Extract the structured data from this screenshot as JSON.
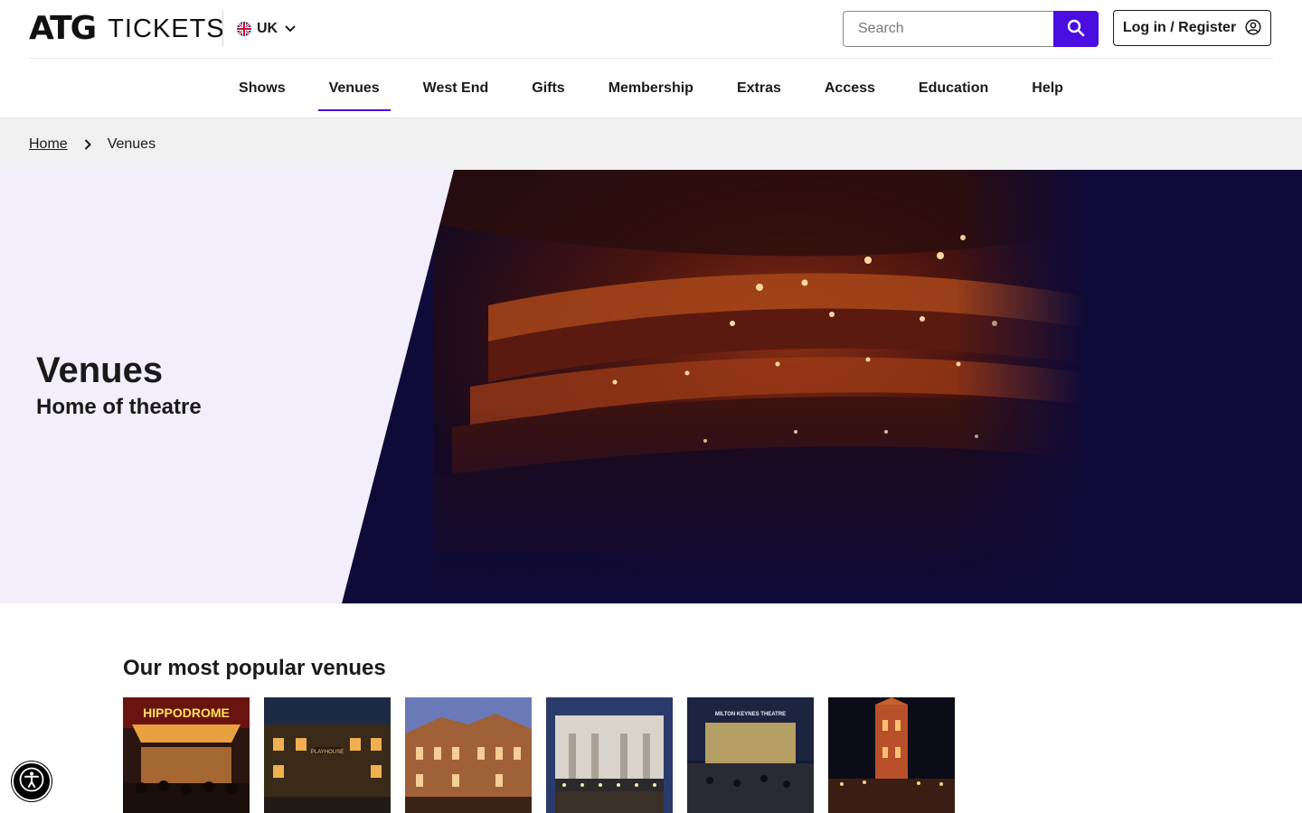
{
  "header": {
    "logo_mark": "ATG",
    "logo_text": "TICKETS",
    "region": {
      "label": "UK",
      "flag_icon": "uk-flag-icon"
    },
    "search": {
      "placeholder": "Search",
      "value": "",
      "icon": "search-icon"
    },
    "login_label": "Log in / Register",
    "login_icon": "user-circle-icon"
  },
  "nav": {
    "items": [
      {
        "label": "Shows",
        "active": false
      },
      {
        "label": "Venues",
        "active": true
      },
      {
        "label": "West End",
        "active": false
      },
      {
        "label": "Gifts",
        "active": false
      },
      {
        "label": "Membership",
        "active": false
      },
      {
        "label": "Extras",
        "active": false
      },
      {
        "label": "Access",
        "active": false
      },
      {
        "label": "Education",
        "active": false
      },
      {
        "label": "Help",
        "active": false
      }
    ]
  },
  "breadcrumb": {
    "home": "Home",
    "current": "Venues"
  },
  "hero": {
    "title": "Venues",
    "subtitle": "Home of theatre"
  },
  "popular": {
    "title": "Our most popular venues",
    "venues": [
      {
        "sign": "HIPPODROME"
      },
      {
        "sign": "PLAYHOUSE"
      },
      {
        "sign": ""
      },
      {
        "sign": ""
      },
      {
        "sign": "MILTON KEYNES THEATRE"
      },
      {
        "sign": ""
      }
    ]
  },
  "colors": {
    "accent": "#4a0ee0",
    "hero_dark": "#0f0a37",
    "hero_light": "#f2eefb",
    "breadcrumb_bg": "#f0f0f0"
  }
}
